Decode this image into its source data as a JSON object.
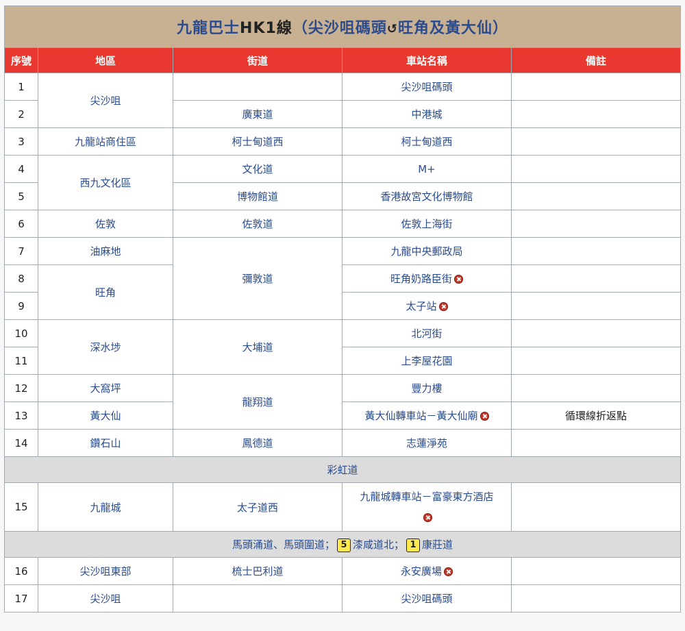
{
  "title": {
    "prefix": "九龍巴士",
    "route": "HK1線",
    "open_paren": "（",
    "from": "尖沙咀碼頭",
    "loop_icon": "↺",
    "to": "旺角及黃大仙",
    "close_paren": "）"
  },
  "headers": [
    "序號",
    "地區",
    "街道",
    "車站名稱",
    "備註"
  ],
  "rows": {
    "r1": {
      "num": "1",
      "district": "尖沙咀",
      "street": "",
      "stop": "尖沙咀碼頭",
      "note": ""
    },
    "r2": {
      "num": "2",
      "street": "廣東道",
      "stop": "中港城",
      "note": ""
    },
    "r3": {
      "num": "3",
      "district": "九龍站商住區",
      "street": "柯士甸道西",
      "stop": "柯士甸道西",
      "note": ""
    },
    "r4": {
      "num": "4",
      "district": "西九文化區",
      "street": "文化道",
      "stop": "M+",
      "note": ""
    },
    "r5": {
      "num": "5",
      "street": "博物館道",
      "stop": "香港故宮文化博物館",
      "note": ""
    },
    "r6": {
      "num": "6",
      "district": "佐敦",
      "street": "佐敦道",
      "stop": "佐敦上海街",
      "note": ""
    },
    "r7": {
      "num": "7",
      "district": "油麻地",
      "street": "彌敦道",
      "stop": "九龍中央郵政局",
      "note": ""
    },
    "r8": {
      "num": "8",
      "district": "旺角",
      "stop": "旺角奶路臣街",
      "note": ""
    },
    "r9": {
      "num": "9",
      "stop": "太子站",
      "note": ""
    },
    "r10": {
      "num": "10",
      "district": "深水埗",
      "street": "大埔道",
      "stop": "北河街",
      "note": ""
    },
    "r11": {
      "num": "11",
      "stop": "上李屋花園",
      "note": ""
    },
    "r12": {
      "num": "12",
      "district": "大窩坪",
      "street": "龍翔道",
      "stop": "豐力樓",
      "note": ""
    },
    "r13": {
      "num": "13",
      "district": "黃大仙",
      "stop": "黃大仙轉車站－黃大仙廟",
      "note": "循環線折返點"
    },
    "r14": {
      "num": "14",
      "district": "鑽石山",
      "street": "鳳德道",
      "stop": "志蓮淨苑",
      "note": ""
    },
    "sep1": {
      "text": "彩虹道"
    },
    "r15": {
      "num": "15",
      "district": "九龍城",
      "street": "太子道西",
      "stop": "九龍城轉車站－富豪東方酒店",
      "note": ""
    },
    "sep2": {
      "part1": "馬頭涌道、馬頭圍道；",
      "badge1": "5",
      "part2": "漆咸道北",
      "semi": "；",
      "badge2": "1",
      "part3": "康莊道"
    },
    "r16": {
      "num": "16",
      "district": "尖沙咀東部",
      "street": "梳士巴利道",
      "stop": "永安廣場",
      "note": ""
    },
    "r17": {
      "num": "17",
      "district": "尖沙咀",
      "street": "",
      "stop": "尖沙咀碼頭",
      "note": ""
    }
  },
  "icons": {
    "closed_stop": "closed-stop-icon",
    "route_badge": "route-number-badge"
  },
  "colors": {
    "header_bg": "#e8382f",
    "title_bg": "#c8b092",
    "separator_bg": "#dcdcdc",
    "link": "#2a4b8d"
  }
}
